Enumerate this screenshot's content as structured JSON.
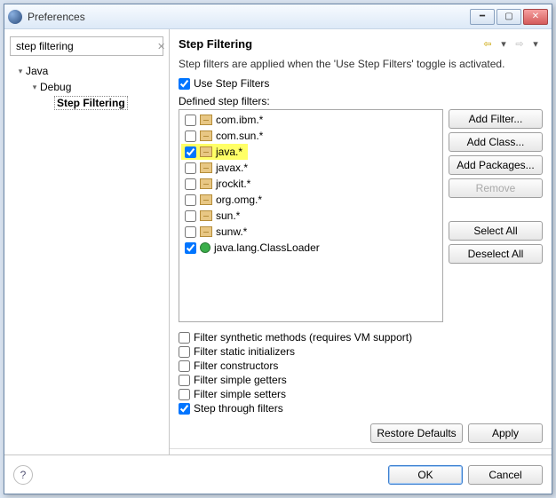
{
  "window": {
    "title": "Preferences"
  },
  "search": {
    "value": "step filtering"
  },
  "tree": {
    "items": [
      {
        "label": "Java",
        "indent": 0,
        "expanded": true
      },
      {
        "label": "Debug",
        "indent": 1,
        "expanded": true
      },
      {
        "label": "Step Filtering",
        "indent": 2,
        "selected": true
      }
    ]
  },
  "page": {
    "title": "Step Filtering",
    "description": "Step filters are applied when the 'Use Step Filters' toggle is activated.",
    "use_step_filters_label": "Use Step Filters",
    "use_step_filters_checked": true,
    "defined_label": "Defined step filters:",
    "filters": [
      {
        "label": "com.ibm.*",
        "checked": false,
        "icon": "pkg"
      },
      {
        "label": "com.sun.*",
        "checked": false,
        "icon": "pkg"
      },
      {
        "label": "java.*",
        "checked": true,
        "icon": "pkg",
        "highlight": true
      },
      {
        "label": "javax.*",
        "checked": false,
        "icon": "pkg"
      },
      {
        "label": "jrockit.*",
        "checked": false,
        "icon": "pkg"
      },
      {
        "label": "org.omg.*",
        "checked": false,
        "icon": "pkg"
      },
      {
        "label": "sun.*",
        "checked": false,
        "icon": "pkg"
      },
      {
        "label": "sunw.*",
        "checked": false,
        "icon": "pkg"
      },
      {
        "label": "java.lang.ClassLoader",
        "checked": true,
        "icon": "cls"
      }
    ],
    "buttons": {
      "add_filter": "Add Filter...",
      "add_class": "Add Class...",
      "add_packages": "Add Packages...",
      "remove": "Remove",
      "select_all": "Select All",
      "deselect_all": "Deselect All"
    },
    "options": [
      {
        "label": "Filter synthetic methods (requires VM support)",
        "checked": false
      },
      {
        "label": "Filter static initializers",
        "checked": false
      },
      {
        "label": "Filter constructors",
        "checked": false
      },
      {
        "label": "Filter simple getters",
        "checked": false
      },
      {
        "label": "Filter simple setters",
        "checked": false
      },
      {
        "label": "Step through filters",
        "checked": true
      }
    ],
    "restore_defaults": "Restore Defaults",
    "apply": "Apply"
  },
  "bottom": {
    "ok": "OK",
    "cancel": "Cancel"
  }
}
